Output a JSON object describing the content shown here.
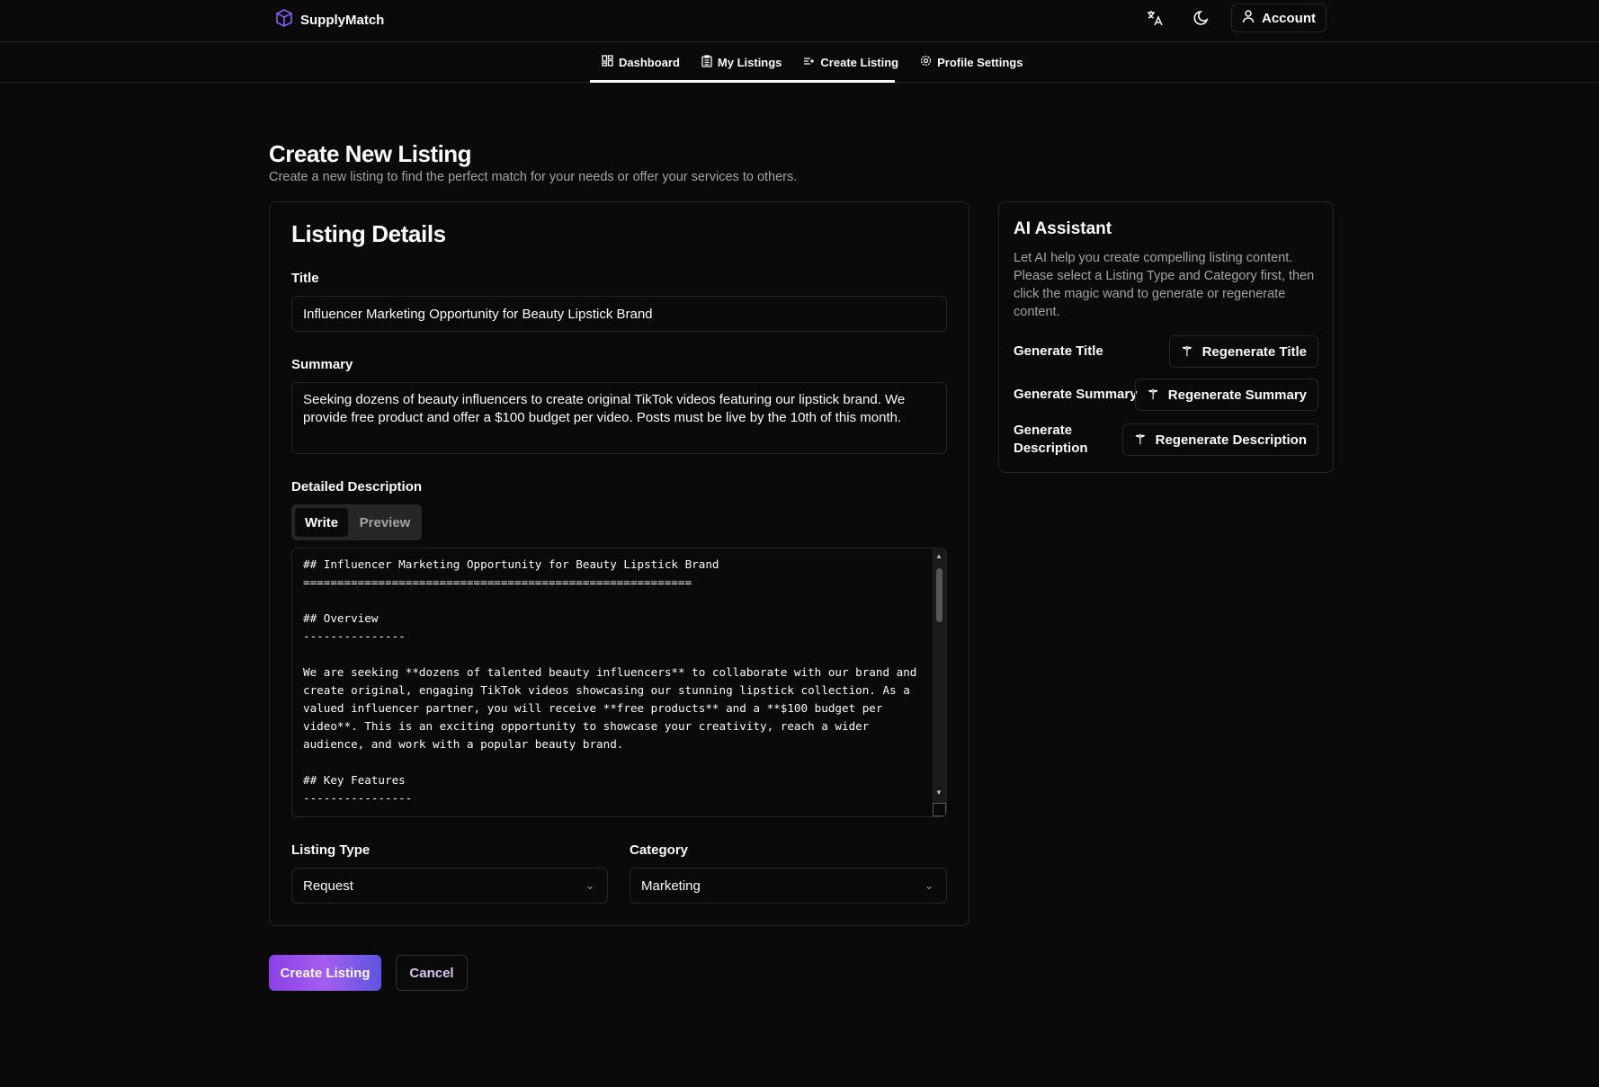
{
  "header": {
    "brand": "SupplyMatch",
    "account_label": "Account",
    "icons": [
      "box-logo-icon",
      "translate-icon",
      "moon-icon",
      "user-icon"
    ]
  },
  "nav": {
    "items": [
      {
        "label": "Dashboard",
        "icon": "dashboard-icon"
      },
      {
        "label": "My Listings",
        "icon": "clipboard-icon"
      },
      {
        "label": "Create Listing",
        "icon": "list-plus-icon"
      },
      {
        "label": "Profile Settings",
        "icon": "gear-icon"
      }
    ]
  },
  "page": {
    "title": "Create New Listing",
    "subtitle": "Create a new listing to find the perfect match for your needs or offer your services to others."
  },
  "form": {
    "heading": "Listing Details",
    "title_label": "Title",
    "title_value": "Influencer Marketing Opportunity for Beauty Lipstick Brand",
    "summary_label": "Summary",
    "summary_value": "Seeking dozens of beauty influencers to create original TikTok videos featuring our lipstick brand. We provide free product and offer a $100 budget per video. Posts must be live by the 10th of this month.",
    "description_label": "Detailed Description",
    "tab_write": "Write",
    "tab_preview": "Preview",
    "description_value": "## Influencer Marketing Opportunity for Beauty Lipstick Brand\n=========================================================\n\n## Overview\n---------------\n\nWe are seeking **dozens of talented beauty influencers** to collaborate with our brand and create original, engaging TikTok videos showcasing our stunning lipstick collection. As a valued influencer partner, you will receive **free products** and a **$100 budget per video**. This is an exciting opportunity to showcase your creativity, reach a wider audience, and work with a popular beauty brand.\n\n## Key Features\n----------------",
    "listing_type_label": "Listing Type",
    "listing_type_value": "Request",
    "category_label": "Category",
    "category_value": "Marketing"
  },
  "actions": {
    "create": "Create Listing",
    "cancel": "Cancel"
  },
  "ai": {
    "heading": "AI Assistant",
    "description": "Let AI help you create compelling listing content. Please select a Listing Type and Category first, then click the magic wand to generate or regenerate content.",
    "rows": [
      {
        "label": "Generate Title",
        "button": "Regenerate Title"
      },
      {
        "label": "Generate Summary",
        "button": "Regenerate Summary"
      },
      {
        "label": "Generate Description",
        "button": "Regenerate Description"
      }
    ]
  },
  "colors": {
    "background": "#0a0a0a",
    "border": "#262626",
    "accent_start": "#8b3fe6",
    "accent_end": "#5b55e0",
    "cancel_text": "#d9c6f5"
  }
}
